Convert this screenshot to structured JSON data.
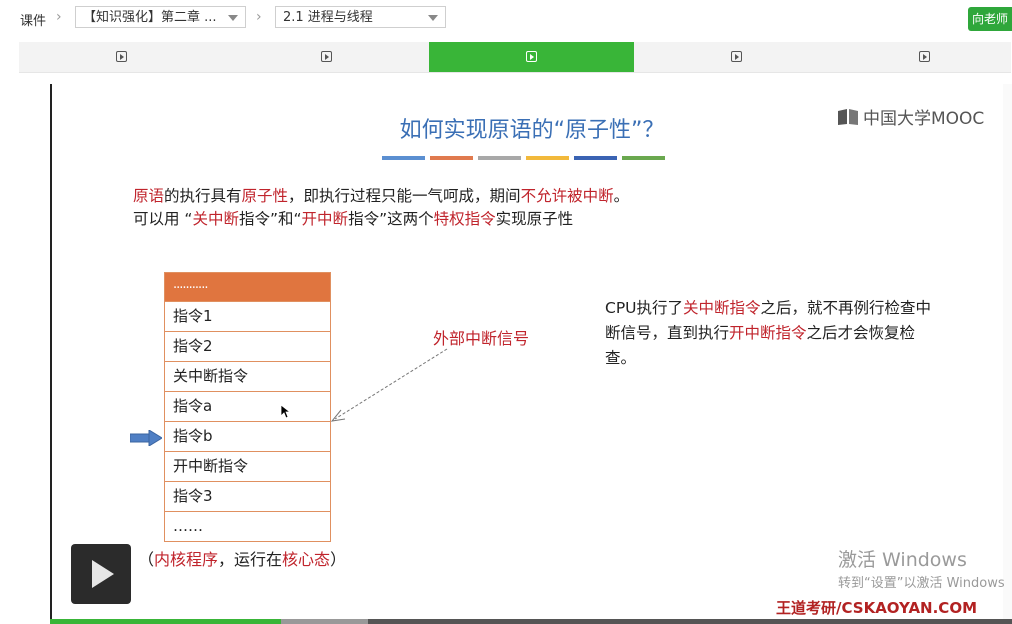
{
  "breadcrumb": {
    "root": "课件",
    "chapter_select": "【知识强化】第二章 ...",
    "section_select": "2.1 进程与线程"
  },
  "teacher_button": "向老师",
  "tabs": [
    {
      "icon": "play-icon",
      "active": false
    },
    {
      "icon": "play-icon",
      "active": false
    },
    {
      "icon": "play-icon",
      "active": true
    },
    {
      "icon": "play-icon",
      "active": false
    },
    {
      "icon": "play-icon",
      "active": false
    }
  ],
  "slide": {
    "logo": "中国大学MOOC",
    "title": "如何实现原语的“原子性”？",
    "color_bar": [
      "#5b8fd1",
      "#e07a4e",
      "#a8a8a8",
      "#f2b93b",
      "#3a63b3",
      "#6aa84f"
    ],
    "line1": [
      {
        "t": "原语",
        "red": true
      },
      {
        "t": "的执行具有",
        "red": false
      },
      {
        "t": "原子性",
        "red": true
      },
      {
        "t": "，即执行过程只能一气呵成，期间",
        "red": false
      },
      {
        "t": "不允许被中断",
        "red": true
      },
      {
        "t": "。",
        "red": false
      }
    ],
    "line2": [
      {
        "t": "可以用 “",
        "red": false
      },
      {
        "t": "关中断",
        "red": true
      },
      {
        "t": "指令”和“",
        "red": false
      },
      {
        "t": "开中断",
        "red": true
      },
      {
        "t": "指令”这两个",
        "red": false
      },
      {
        "t": "特权指令",
        "red": true
      },
      {
        "t": "实现原子性",
        "red": false
      }
    ],
    "table_rows": [
      "...........",
      "指令1",
      "指令2",
      "关中断指令",
      "指令a",
      "指令b",
      "开中断指令",
      "指令3",
      "……"
    ],
    "external_interrupt_label": "外部中断信号",
    "right_note": [
      {
        "t": "CPU执行了",
        "red": false
      },
      {
        "t": "关中断指令",
        "red": true
      },
      {
        "t": "之后，就不再例行检查中断信号，直到执行",
        "red": false
      },
      {
        "t": "开中断指令",
        "red": true
      },
      {
        "t": "之后才会恢复检查。",
        "red": false
      }
    ],
    "kernel_note": [
      {
        "t": "（",
        "red": false
      },
      {
        "t": "内核程序",
        "red": true
      },
      {
        "t": "，运行在",
        "red": false
      },
      {
        "t": "核心态",
        "red": true
      },
      {
        "t": "）",
        "red": false
      }
    ],
    "footer_brand": "王道考研/CSKAOYAN.COM"
  },
  "watermark": {
    "line1": "激活 Windows",
    "line2": "转到“设置”以激活 Windows"
  },
  "progress": {
    "played_fraction": 0.24,
    "buffered_fraction": 0.33
  }
}
